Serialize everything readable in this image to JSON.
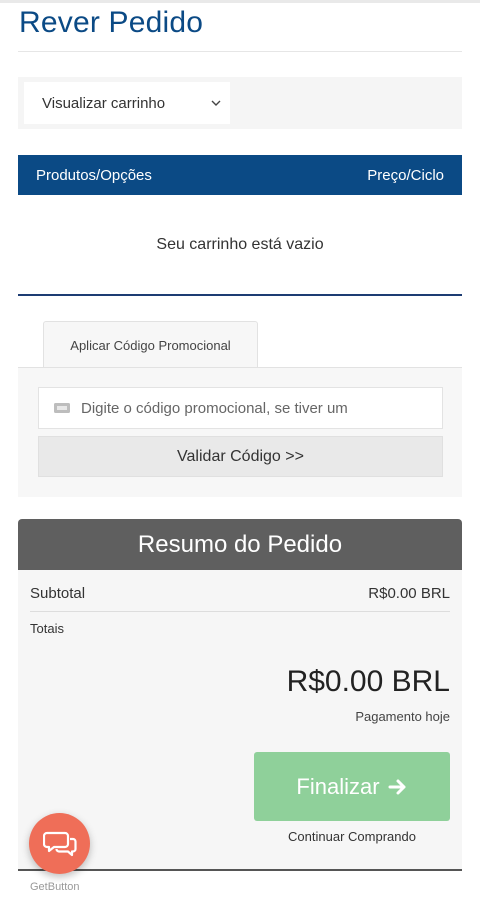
{
  "page": {
    "title": "Rever Pedido"
  },
  "view_selector": {
    "selected": "Visualizar carrinho"
  },
  "cart": {
    "columns": [
      "Produtos/Opções",
      "Preço/Ciclo"
    ],
    "empty_message": "Seu carrinho está vazio"
  },
  "promo": {
    "tab_label": "Aplicar Código Promocional",
    "input_placeholder": "Digite o código promocional, se tiver um",
    "validate_label": "Validar Código >>"
  },
  "summary": {
    "title": "Resumo do Pedido",
    "subtotal_label": "Subtotal",
    "subtotal_value": "R$0.00 BRL",
    "totals_label": "Totais",
    "total_amount": "R$0.00 BRL",
    "payment_note": "Pagamento hoje",
    "checkout_label": "Finalizar",
    "continue_label": "Continuar Comprando"
  },
  "widget": {
    "label": "GetButton"
  },
  "colors": {
    "brand_blue": "#0b4a85",
    "summary_header": "#5f5f5f",
    "checkout_green": "#8fd09a",
    "chat_button": "#ef6e58"
  },
  "icons": {
    "view_select": "chevron-down-icon",
    "promo_input": "ticket-icon",
    "checkout": "arrow-right-icon",
    "chat": "chat-bubbles-icon"
  }
}
